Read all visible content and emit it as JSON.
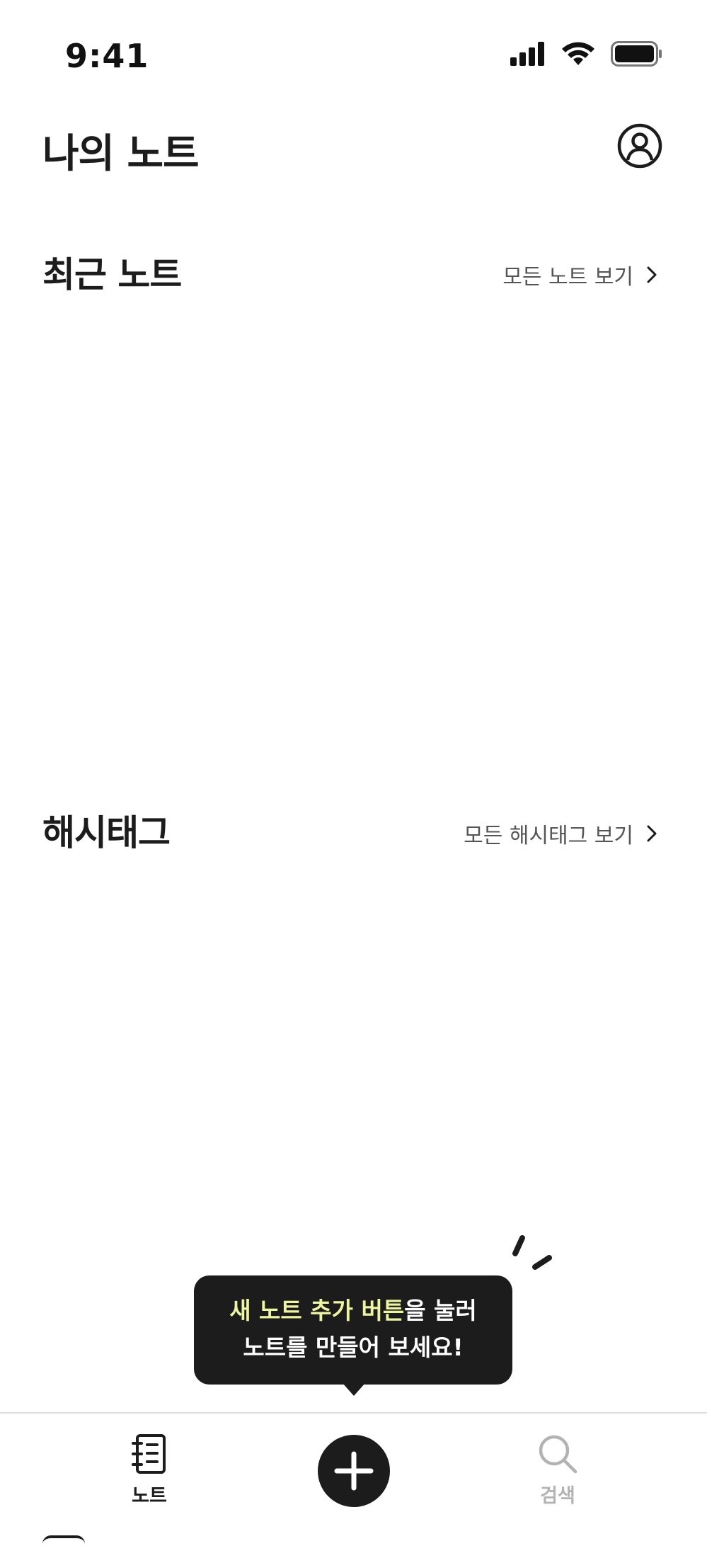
{
  "status_bar": {
    "time": "9:41"
  },
  "header": {
    "title": "나의 노트"
  },
  "recent_section": {
    "title": "최근 노트",
    "see_all_label": "모든 노트 보기"
  },
  "hashtag_section": {
    "title": "해시태그",
    "see_all_label": "모든 해시태그 보기"
  },
  "tooltip": {
    "highlight": "새 노트 추가 버튼",
    "line1_rest": "을 눌러",
    "line2": "노트를 만들어 보세요!"
  },
  "tab_bar": {
    "notes_label": "노트",
    "search_label": "검색"
  },
  "colors": {
    "text": "#1c1c1c",
    "tooltip_bg": "#1c1c1c",
    "tooltip_highlight": "#eef5a0",
    "inactive_tab": "#b3b3b3"
  },
  "icons": {
    "profile": "profile-icon",
    "chevron": "chevron-right-icon",
    "notes_tab": "notebook-icon",
    "add": "plus-icon",
    "search_tab": "search-icon"
  }
}
